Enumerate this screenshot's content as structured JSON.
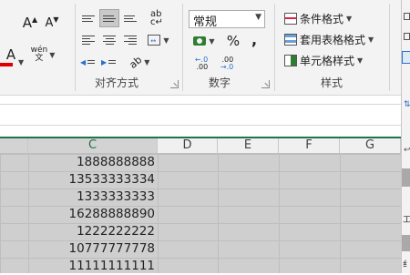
{
  "font": {
    "grow_label": "A",
    "shrink_label": "A",
    "color_label": "A",
    "phonetic_label": "wén"
  },
  "alignment": {
    "group_label": "对齐方式",
    "wrap_label": "ab",
    "orientation_label": "ab"
  },
  "number": {
    "group_label": "数字",
    "format_value": "常规",
    "percent_label": "%",
    "comma_label": ",",
    "inc_decimal_label": ".00",
    "dec_decimal_label": ".0"
  },
  "styles": {
    "group_label": "样式",
    "conditional_label": "条件格式",
    "table_label": "套用表格格式",
    "cell_label": "单元格样式"
  },
  "columns": [
    {
      "label": "C",
      "active": true
    },
    {
      "label": "D",
      "active": false
    },
    {
      "label": "E",
      "active": false
    },
    {
      "label": "F",
      "active": false
    },
    {
      "label": "G",
      "active": false
    }
  ],
  "cells": [
    "1888888888",
    "13533333334",
    "1333333333",
    "16288888890",
    "1222222222",
    "10777777778",
    "11111111111"
  ],
  "pane_text": [
    "",
    "",
    "工",
    "纟"
  ],
  "colors": {
    "accent": "#217346",
    "font_color_bar": "#e00000",
    "selection": "#cfcfcf"
  }
}
